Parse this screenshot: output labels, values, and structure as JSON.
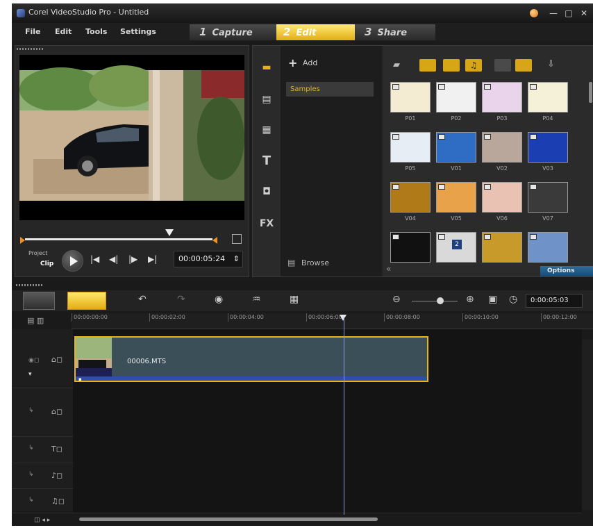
{
  "window": {
    "title": "Corel VideoStudio Pro - Untitled",
    "minimize": "—",
    "maximize": "□",
    "close": "✕"
  },
  "menu": {
    "file": "File",
    "edit": "Edit",
    "tools": "Tools",
    "settings": "Settings"
  },
  "steps": [
    {
      "num": "1",
      "label": "Capture"
    },
    {
      "num": "2",
      "label": "Edit"
    },
    {
      "num": "3",
      "label": "Share"
    }
  ],
  "player": {
    "mode_project": "Project",
    "mode_clip": "Clip",
    "timecode": "00:00:05:24",
    "scrub_position_fraction": 0.77,
    "transport": {
      "start": "|◀",
      "prev": "◀|",
      "next": "|▶",
      "end": "▶|"
    }
  },
  "library": {
    "add_label": "Add",
    "folders": [
      "Samples"
    ],
    "browse_label": "Browse",
    "options_label": "Options",
    "side_icons": [
      "media-icon",
      "instant-project-icon",
      "transition-icon",
      "title-icon",
      "graphic-icon",
      "filter-icon"
    ],
    "thumbnails": [
      {
        "label": "P01",
        "color": "#f4ecd2"
      },
      {
        "label": "P02",
        "color": "#f1f1f1"
      },
      {
        "label": "P03",
        "color": "#e9d4ec"
      },
      {
        "label": "P04",
        "color": "#f5f0d8"
      },
      {
        "label": "P05",
        "color": "#e6edf5"
      },
      {
        "label": "V01",
        "color": "#2f6cc4"
      },
      {
        "label": "V02",
        "color": "#b8a79a"
      },
      {
        "label": "V03",
        "color": "#1b3fb2"
      },
      {
        "label": "V04",
        "color": "#b07a18"
      },
      {
        "label": "V05",
        "color": "#e8a24a"
      },
      {
        "label": "V06",
        "color": "#eac2b4"
      },
      {
        "label": "V07",
        "color": "#3a3a3a"
      },
      {
        "label": "",
        "color": "#111111"
      },
      {
        "label": "2",
        "color": "#d9d9d9"
      },
      {
        "label": "",
        "color": "#c89a2a"
      },
      {
        "label": "",
        "color": "#6f93c9"
      }
    ]
  },
  "timeline": {
    "timecode": "0:00:05:03",
    "ruler": [
      "00:00:00:00",
      "00:00:02:00",
      "00:00:04:00",
      "00:00:06:00",
      "00:00:08:00",
      "00:00:10:00",
      "00:00:12:00"
    ],
    "clip_name": "00006.MTS",
    "tracks": [
      "video",
      "overlay",
      "title",
      "voice",
      "music"
    ]
  },
  "colors": {
    "accent": "#e8b612",
    "clip": "#3a4f58",
    "playhead": "#8a9cd8"
  }
}
